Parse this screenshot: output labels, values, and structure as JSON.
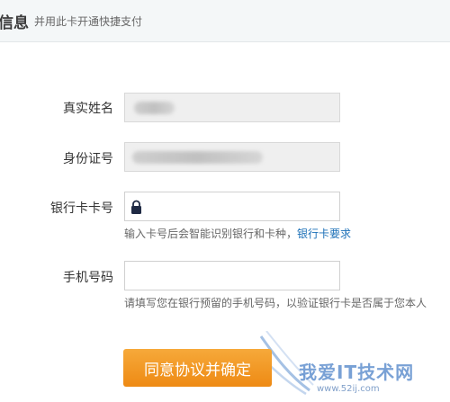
{
  "header": {
    "title": "信息",
    "subtitle": "并用此卡开通快捷支付"
  },
  "form": {
    "real_name_label": "真实姓名",
    "id_number_label": "身份证号",
    "card_number_label": "银行卡卡号",
    "card_hint": "输入卡号后会智能识别银行和卡种，",
    "card_hint_link": "银行卡要求",
    "phone_label": "手机号码",
    "phone_hint": "请填写您在银行预留的手机号码，以验证银行卡是否属于您本人",
    "submit_label": "同意协议并确定"
  },
  "watermark": {
    "text": "我爱IT技术网",
    "url": "www.52ij.com"
  },
  "colors": {
    "accent": "#ee8a14",
    "link": "#1a6fb7"
  },
  "icons": {
    "card_field_icon": "lock-icon"
  }
}
